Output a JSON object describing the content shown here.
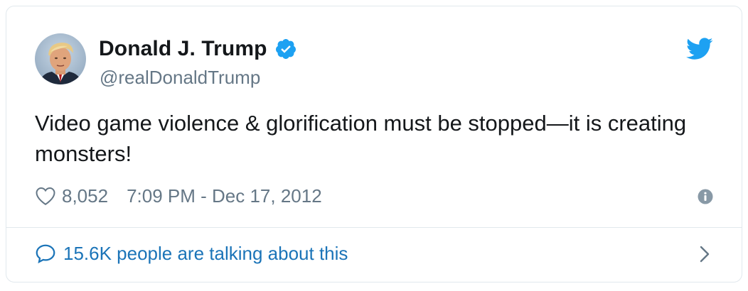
{
  "user": {
    "display_name": "Donald J. Trump",
    "handle": "@realDonaldTrump",
    "verified": true,
    "avatar_icon": "profile-photo"
  },
  "tweet": {
    "text": "Video game violence & glorification must be stopped—it is creating monsters!"
  },
  "meta": {
    "likes": "8,052",
    "timestamp": "7:09 PM - Dec 17, 2012"
  },
  "footer": {
    "talking_label": "15.6K people are talking about this"
  },
  "icons": {
    "bird": "twitter-bird-icon",
    "verified": "verified-badge-icon",
    "heart": "heart-icon",
    "info": "info-icon",
    "bubble": "speech-bubble-icon",
    "chevron": "chevron-right-icon"
  },
  "colors": {
    "twitter_blue": "#1da1f2",
    "link_blue": "#1b74b8",
    "muted_gray": "#657786",
    "border": "#e1e8ed",
    "text": "#14171a"
  }
}
